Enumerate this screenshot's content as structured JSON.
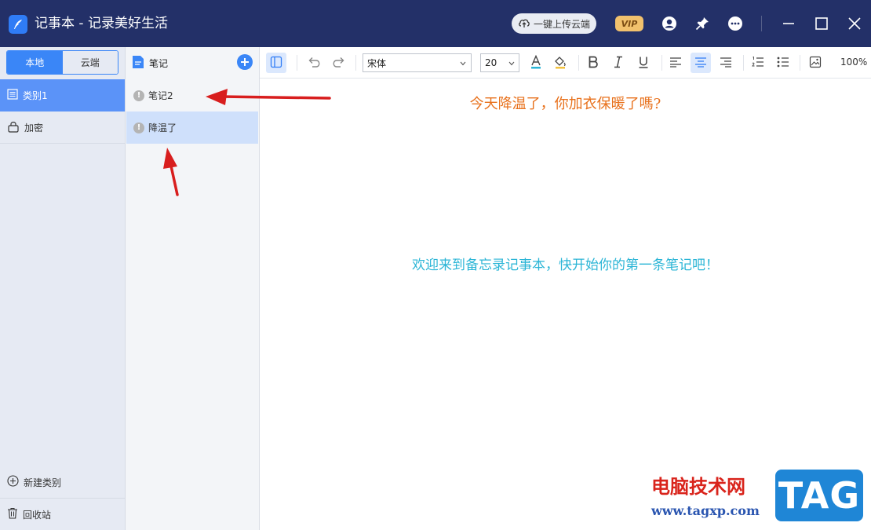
{
  "titlebar": {
    "title": "记事本 - 记录美好生活",
    "upload_label": "一键上传云端",
    "vip_label": "VIP",
    "icons": [
      "feather-icon",
      "cloud-upload-icon",
      "user-icon",
      "pin-icon",
      "more-icon",
      "minimize-icon",
      "maximize-icon",
      "close-icon"
    ]
  },
  "sidebar": {
    "tabs": [
      {
        "label": "本地",
        "active": true
      },
      {
        "label": "云端",
        "active": false
      }
    ],
    "categories": [
      {
        "label": "类别1",
        "icon": "list-icon",
        "active": true
      },
      {
        "label": "加密",
        "icon": "lock-icon",
        "active": false
      }
    ],
    "new_category_label": "新建类别",
    "recycle_label": "回收站"
  },
  "notelist": {
    "header": "笔记",
    "notes": [
      {
        "title": "笔记2",
        "selected": false
      },
      {
        "title": "降温了",
        "selected": true
      }
    ]
  },
  "toolbar": {
    "font_name": "宋体",
    "font_size": "20",
    "zoom": "100%"
  },
  "editor": {
    "note_title": "今天降温了，你加衣保暖了嗎?",
    "welcome": "欢迎来到备忘录记事本，快开始你的第一条笔记吧！"
  },
  "watermark": {
    "line1": "电脑技术网",
    "line2": "www.tagxp.com",
    "badge": "TAG"
  },
  "colors": {
    "titlebar_bg": "#233068",
    "accent": "#3a86f7",
    "note_title": "#e8711c",
    "welcome": "#2bb5d6",
    "arrow": "#d81e1e"
  }
}
